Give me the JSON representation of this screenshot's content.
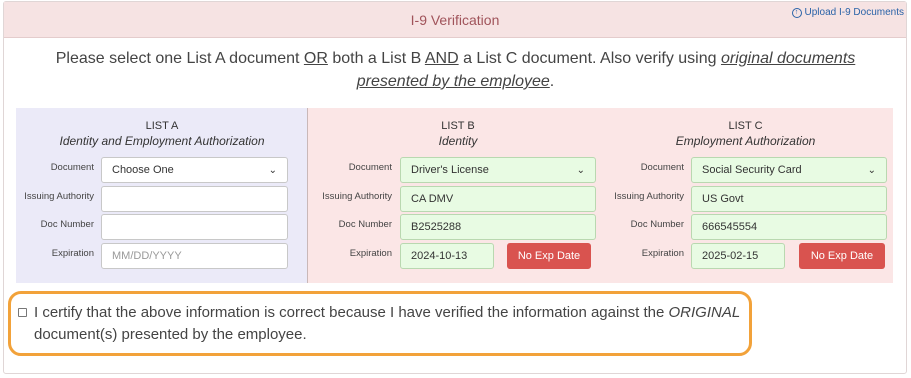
{
  "header": {
    "title": "I-9 Verification",
    "upload_link": "Upload I-9 Documents",
    "upload_icon": "arrow-up-circle-icon"
  },
  "instructions": {
    "part1": "Please select one List A document ",
    "or": "OR",
    "part2": " both a List B ",
    "and": "AND",
    "part3": " a List C document. Also verify using ",
    "original": "original documents presented by the employee",
    "part4": "."
  },
  "list_a": {
    "title": "LIST A",
    "subtitle": "Identity and Employment Authorization",
    "labels": {
      "document": "Document",
      "issuing_authority": "Issuing Authority",
      "doc_number": "Doc Number",
      "expiration": "Expiration"
    },
    "document": "Choose One",
    "issuing_authority": "",
    "doc_number": "",
    "expiration_placeholder": "MM/DD/YYYY"
  },
  "list_b": {
    "title": "LIST B",
    "subtitle": "Identity",
    "labels": {
      "document": "Document",
      "issuing_authority": "Issuing Authority",
      "doc_number": "Doc Number",
      "expiration": "Expiration"
    },
    "document": "Driver's License",
    "issuing_authority": "CA DMV",
    "doc_number": "B2525288",
    "expiration": "2024-10-13",
    "no_exp_button": "No Exp Date"
  },
  "list_c": {
    "title": "LIST C",
    "subtitle": "Employment Authorization",
    "labels": {
      "document": "Document",
      "issuing_authority": "Issuing Authority",
      "doc_number": "Doc Number",
      "expiration": "Expiration"
    },
    "document": "Social Security Card",
    "issuing_authority": "US Govt",
    "doc_number": "666545554",
    "expiration": "2025-02-15",
    "no_exp_button": "No Exp Date"
  },
  "certify": {
    "text1": "I certify that the above information is correct because I have verified the information against the ",
    "original": "ORIGINAL",
    "text2": " document(s) presented by the employee.",
    "checked": false
  },
  "colors": {
    "header_bg": "#f6e3e3",
    "title_color": "#a0535a",
    "list_a_bg": "#ebeaf8",
    "list_bc_bg": "#fbe6e6",
    "filled_field_bg": "#e8fbe3",
    "button_red": "#d9534f",
    "highlight_orange": "#f2a23a",
    "link_blue": "#2a63a8"
  }
}
